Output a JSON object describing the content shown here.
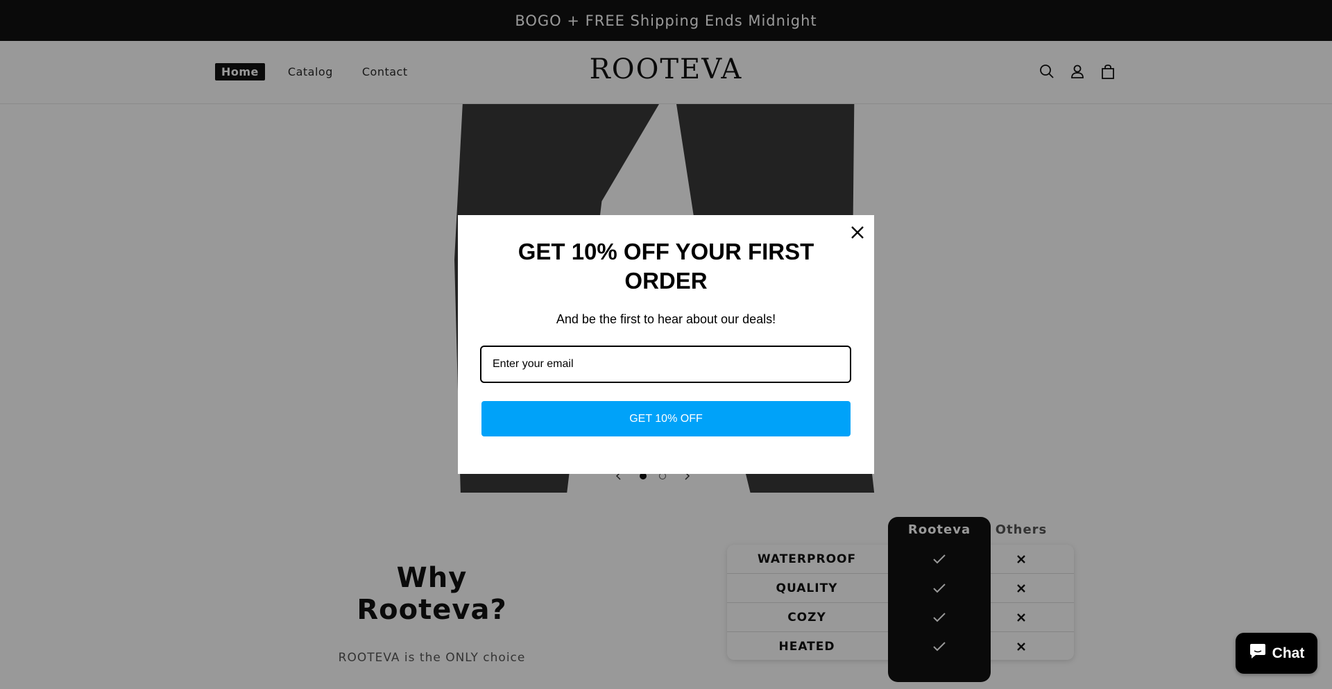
{
  "announcement": "BOGO + FREE Shipping Ends Midnight",
  "header": {
    "logo": "ROOTEVA",
    "nav": [
      "Home",
      "Catalog",
      "Contact"
    ],
    "icons": [
      "search-icon",
      "account-icon",
      "cart-icon"
    ]
  },
  "slideshow": {
    "slides": 2,
    "current_slide": 1
  },
  "why": {
    "title": "Why Rooteva?",
    "subtitle": "ROOTEVA is the ONLY choice"
  },
  "comparison": {
    "columns": [
      "Rooteva",
      "Others"
    ],
    "rows": [
      {
        "feature": "WATERPROOF",
        "rooteva": "check-icon",
        "others": "x-icon"
      },
      {
        "feature": "QUALITY",
        "rooteva": "check-icon",
        "others": "x-icon"
      },
      {
        "feature": "COZY",
        "rooteva": "check-icon",
        "others": "x-icon"
      },
      {
        "feature": "HEATED",
        "rooteva": "check-icon",
        "others": "x-icon"
      }
    ]
  },
  "popup": {
    "title": "GET 10% OFF YOUR FIRST ORDER",
    "subtitle": "And be the first to hear about our deals!",
    "email_placeholder": "Enter your email",
    "button": "GET 10% OFF"
  },
  "chat": {
    "label": "Chat"
  },
  "colors": {
    "accent": "#00a2f9",
    "dark": "#121212",
    "overlay": "rgba(0,0,0,0.4)"
  }
}
